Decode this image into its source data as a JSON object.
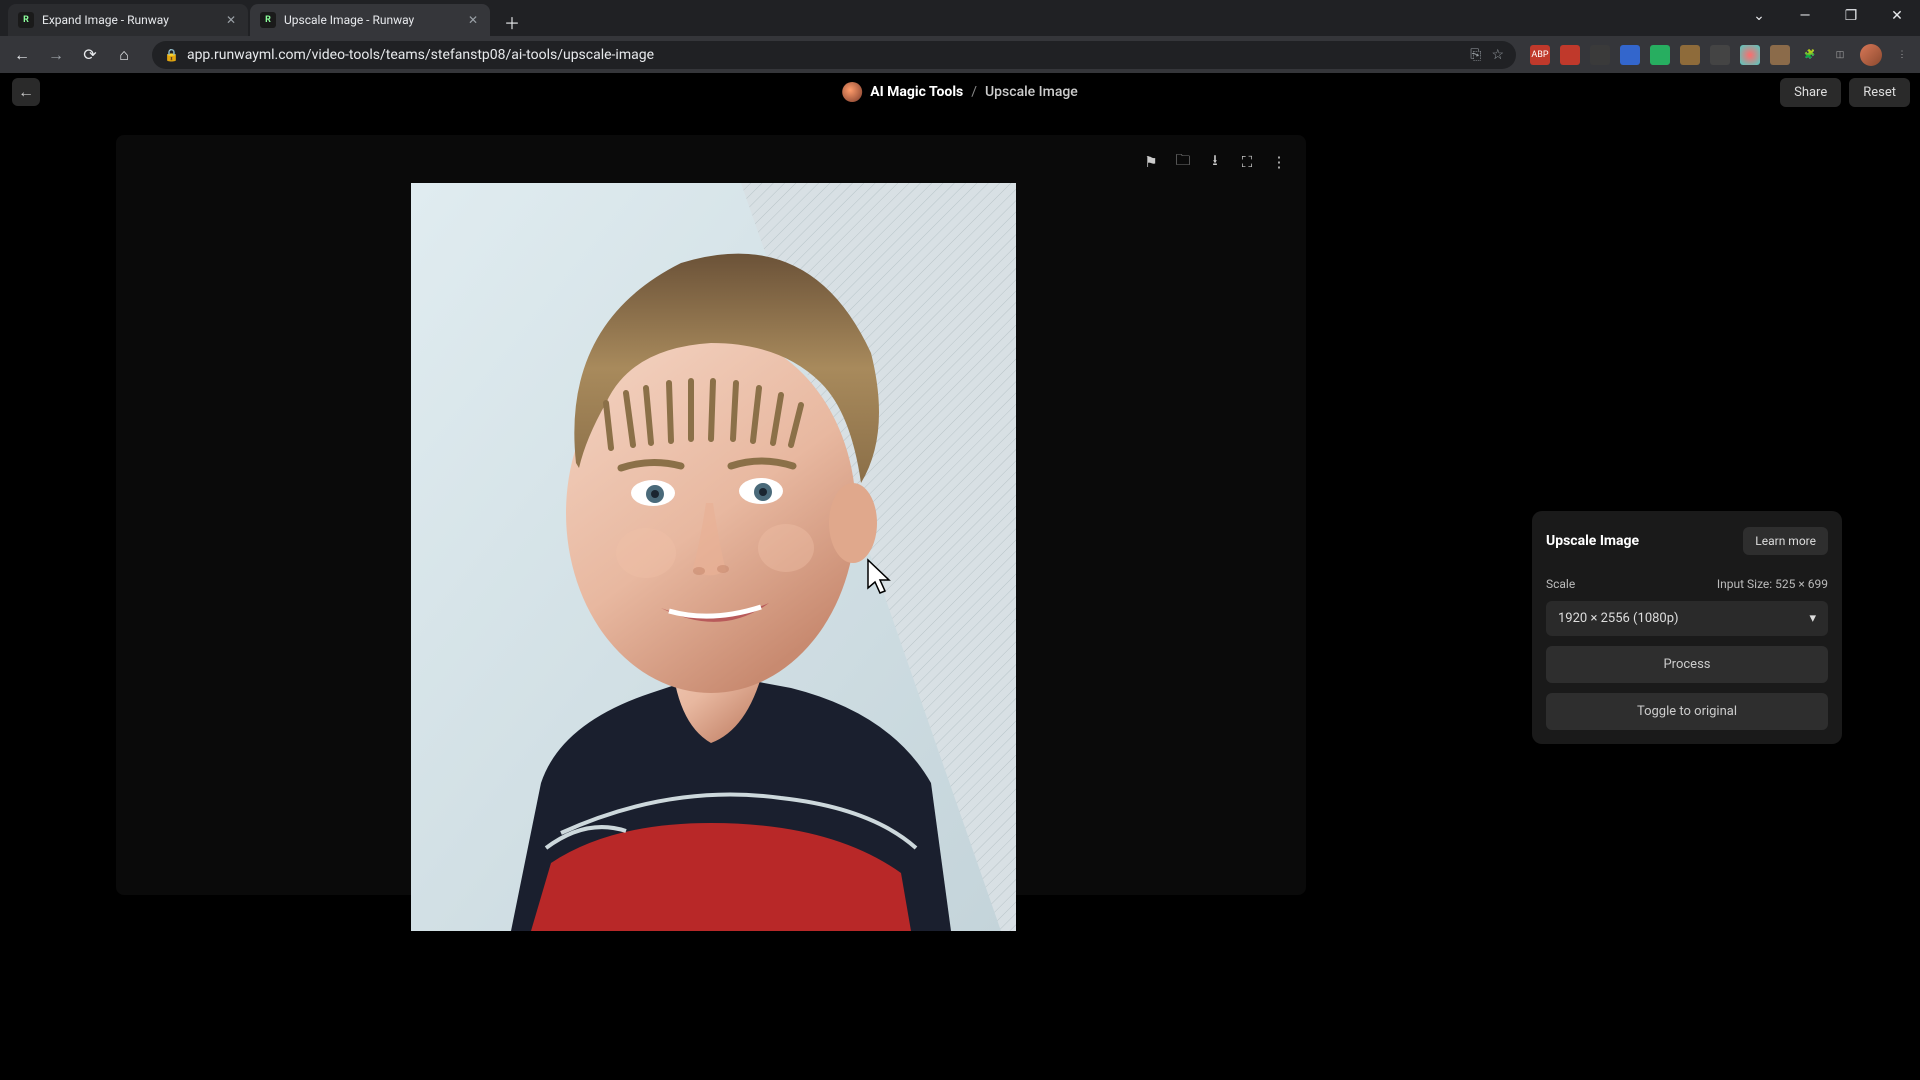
{
  "browser": {
    "tabs": [
      {
        "title": "Expand Image - Runway",
        "favicon": "R"
      },
      {
        "title": "Upscale Image - Runway",
        "favicon": "R"
      }
    ],
    "active_tab": 1,
    "url": "app.runwayml.com/video-tools/teams/stefanstp08/ai-tools/upscale-image"
  },
  "header": {
    "breadcrumb_root": "AI Magic Tools",
    "breadcrumb_page": "Upscale Image",
    "share": "Share",
    "reset": "Reset"
  },
  "panel": {
    "title": "Upscale Image",
    "learn_more": "Learn more",
    "scale_label": "Scale",
    "input_size_label": "Input Size: 525 × 699",
    "select_value": "1920 × 2556 (1080p)",
    "process": "Process",
    "toggle": "Toggle to original"
  }
}
